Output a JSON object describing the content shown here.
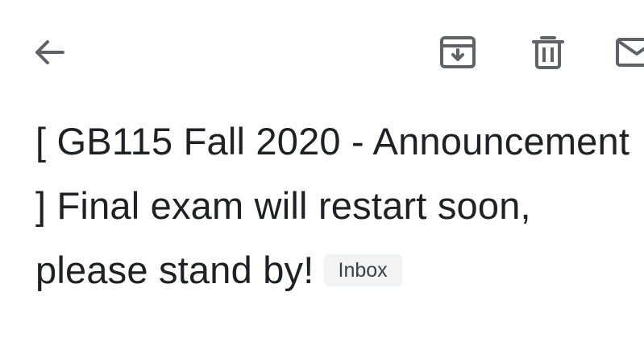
{
  "toolbar": {
    "back_icon": "arrow-back-icon",
    "archive_icon": "archive-icon",
    "delete_icon": "trash-icon",
    "mark_unread_icon": "mail-icon",
    "icon_color": "#5f6368"
  },
  "email": {
    "subject": "[ GB115 Fall 2020 - Announcement ] Final exam will restart soon, please stand by!",
    "label": "Inbox"
  },
  "colors": {
    "text": "#202124",
    "chip_background": "#f1f3f4",
    "chip_text": "#3c4043"
  }
}
